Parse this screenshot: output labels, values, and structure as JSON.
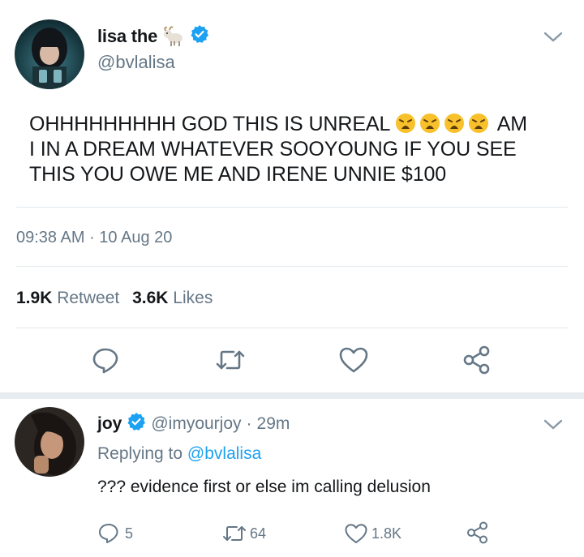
{
  "tweet": {
    "display_name": "lisa the",
    "name_emoji": "goat-emoji",
    "handle": "@bvlalisa",
    "text_part1": "OHHHHHHHHH GOD THIS IS UNREAL",
    "text_part2": "AM",
    "text_line2": "I IN A DREAM WHATEVER SOOYOUNG IF YOU SEE",
    "text_line3": "THIS YOU OWE ME AND IRENE UNNIE $100",
    "time": "09:38 AM",
    "date": "10 Aug 20",
    "retweets_count": "1.9K",
    "retweets_label": "Retweet",
    "likes_count": "3.6K",
    "likes_label": "Likes"
  },
  "reply": {
    "display_name": "joy",
    "handle": "@imyourjoy",
    "time": "29m",
    "replying_prefix": "Replying to",
    "replying_handle": "@bvlalisa",
    "text": "??? evidence first or else im calling delusion",
    "reply_count": "5",
    "retweet_count": "64",
    "like_count": "1.8K"
  },
  "colors": {
    "verified": "#1da1f2",
    "link": "#1da1f2",
    "muted": "#657786",
    "text": "#14171a",
    "divider": "#e1e8ed",
    "icon": "#657786"
  }
}
